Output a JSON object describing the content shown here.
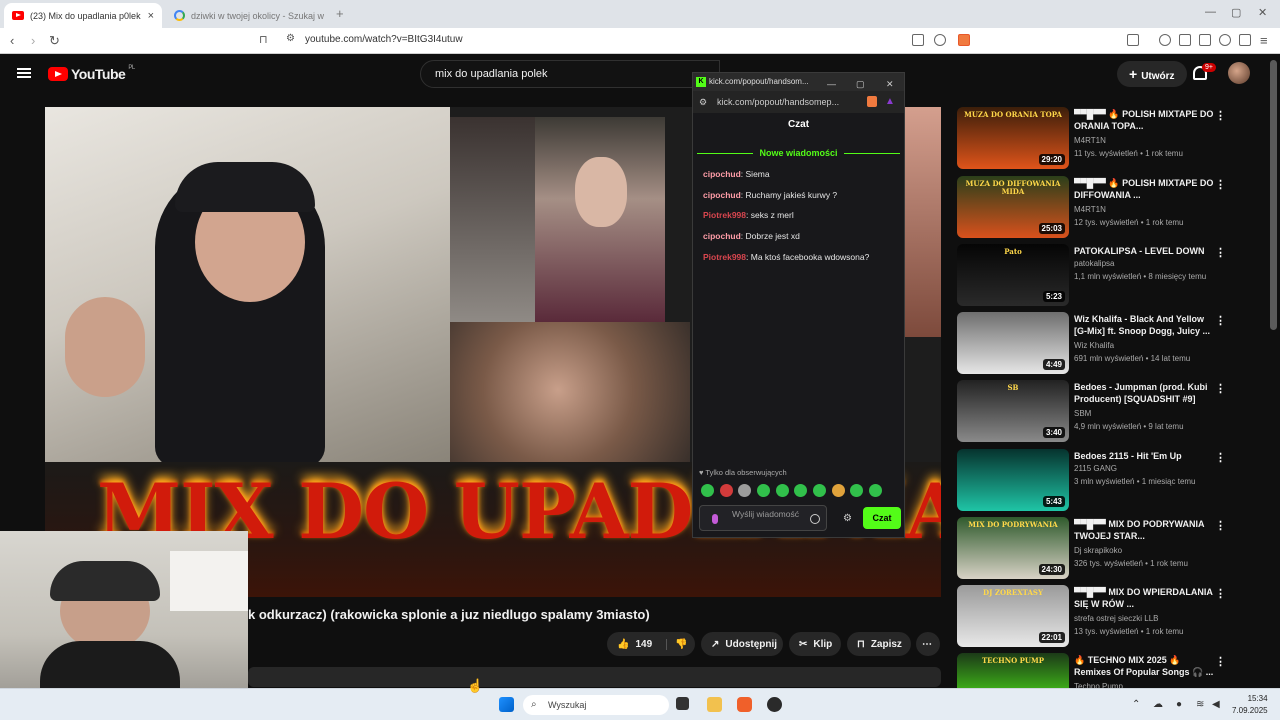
{
  "browser": {
    "tabs": [
      {
        "title": "(23) Mix do upadlania p0lek",
        "active": true
      },
      {
        "title": "dziwki w twojej okolicy - Szukaj w G...",
        "active": false
      }
    ],
    "new_tab_icon": "plus-icon",
    "url": "youtube.com/watch?v=BItG3I4utuw"
  },
  "youtube": {
    "logo_text": "YouTube",
    "logo_region": "PL",
    "search_query": "mix do upadlania polek",
    "create_label": "Utwórz",
    "notif_badge": "9+"
  },
  "video": {
    "overlay_text": "MIX DO UPADLANIA POLEK",
    "title_visible": "k odkurzacz) (rakowicka splonie a juz niedlugo spalamy 3miasto)",
    "like_count": "149",
    "share_label": "Udostępnij",
    "clip_label": "Klip",
    "save_label": "Zapisz"
  },
  "popup": {
    "window_title": "kick.com/popout/handsom...",
    "url": "kick.com/popout/handsomep...",
    "chat_header": "Czat",
    "new_messages": "Nowe wiadomości",
    "messages": [
      {
        "user": "cipochud",
        "text": "Siema",
        "color": "#ff9da8"
      },
      {
        "user": "cipochud",
        "text": "Ruchamy jakieś kurwy ?",
        "color": "#ff9da8"
      },
      {
        "user": "Piotrek998",
        "text": "seks z merl",
        "color": "#d8464f"
      },
      {
        "user": "cipochud",
        "text": "Dobrze jest xd",
        "color": "#ff9da8"
      },
      {
        "user": "Piotrek998",
        "text": "Ma ktoś facebooka wdowsona?",
        "color": "#d8464f"
      }
    ],
    "followers_only": "Tylko dla obserwujących",
    "input_placeholder": "Wyślij wiadomość",
    "send_label": "Czat",
    "accent": "#53fc18"
  },
  "recommendations": [
    {
      "title": "▀▀█▀▀ 🔥 POLISH MIXTAPE DO ORANIA TOPA...",
      "channel": "M4RT1N",
      "meta": "11 tys. wyświetleń • 1 rok temu",
      "duration": "29:20",
      "thumb_text": "MUZA DO ORANIA TOPA",
      "colors": [
        "#3b1e0a",
        "#e0541a"
      ]
    },
    {
      "title": "▀▀█▀▀ 🔥 POLISH MIXTAPE DO DIFFOWANIA ...",
      "channel": "M4RT1N",
      "meta": "12 tys. wyświetleń • 1 rok temu",
      "duration": "25:03",
      "thumb_text": "MUZA DO DIFFOWANIA MIDA",
      "colors": [
        "#2b3f1a",
        "#d9511c"
      ]
    },
    {
      "title": "PATOKALIPSA - LEVEL DOWN",
      "channel": "patokalipsa",
      "meta": "1,1 mln wyświetleń • 8 miesięcy temu",
      "duration": "5:23",
      "thumb_text": "Pato",
      "colors": [
        "#050505",
        "#2a2a2a"
      ]
    },
    {
      "title": "Wiz Khalifa - Black And Yellow [G-Mix] ft. Snoop Dogg, Juicy ...",
      "channel": "Wiz Khalifa",
      "meta": "691 mln wyświetleń • 14 lat temu",
      "duration": "4:49",
      "thumb_text": "",
      "colors": [
        "#6e6e6e",
        "#e6e6e6"
      ]
    },
    {
      "title": "Bedoes - Jumpman (prod. Kubi Producent) [SQUADSHIT #9]",
      "channel": "SBM",
      "meta": "4,9 mln wyświetleń • 9 lat temu",
      "duration": "3:40",
      "thumb_text": "SB",
      "colors": [
        "#222222",
        "#8a8a8a"
      ]
    },
    {
      "title": "Bedoes 2115 - Hit 'Em Up",
      "channel": "2115 GANG",
      "meta": "3 mln wyświetleń • 1 miesiąc temu",
      "duration": "5:43",
      "thumb_text": "",
      "colors": [
        "#06332e",
        "#1fc5a6"
      ]
    },
    {
      "title": "▀▀█▀▀ MIX DO PODRYWANIA TWOJEJ STAR...",
      "channel": "Dj skrapikoko",
      "meta": "326 tys. wyświetleń • 1 rok temu",
      "duration": "24:30",
      "thumb_text": "MIX DO PODRYWANIA",
      "colors": [
        "#2f5a2c",
        "#d8d2c6"
      ]
    },
    {
      "title": "▀▀█▀▀ MIX DO WPIERDALANIA SIĘ W RÓW ...",
      "channel": "strefa ostrej sieczki LLB",
      "meta": "13 tys. wyświetleń • 1 rok temu",
      "duration": "22:01",
      "thumb_text": "DJ ZOREXTASY",
      "colors": [
        "#9a9a9a",
        "#e8e8e8"
      ]
    },
    {
      "title": "🔥 TECHNO MIX 2025 🔥 Remixes Of Popular Songs 🎧 ...",
      "channel": "Techno Pump",
      "meta": "",
      "duration": "",
      "thumb_text": "TECHNO PUMP",
      "colors": [
        "#1c3a18",
        "#53fc18"
      ]
    }
  ],
  "taskbar": {
    "search_placeholder": "Wyszukaj",
    "time": "15:34",
    "date": "7.09.2025"
  }
}
